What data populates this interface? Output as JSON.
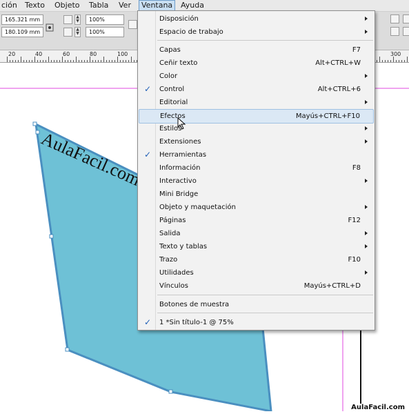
{
  "menubar": {
    "items": [
      "ción",
      "Texto",
      "Objeto",
      "Tabla",
      "Ver",
      "Ventana",
      "Ayuda"
    ],
    "active": "Ventana"
  },
  "toolbar": {
    "x_value": "165.321 mm",
    "y_value": "180.109 mm",
    "scale_x": "100%",
    "scale_y": "100%"
  },
  "ruler": {
    "labels": [
      "20",
      "40",
      "60",
      "80",
      "100",
      "300"
    ]
  },
  "canvas": {
    "shape_text": "AulaFacil.com",
    "shape_color": "#6ec1d6",
    "shape_border_color": "#4a8fc0"
  },
  "menu": {
    "items": [
      {
        "label": "Disposición",
        "submenu": true
      },
      {
        "label": "Espacio de trabajo",
        "submenu": true
      },
      {
        "label": "Capas",
        "shortcut": "F7"
      },
      {
        "label": "Ceñir texto",
        "shortcut": "Alt+CTRL+W"
      },
      {
        "label": "Color",
        "submenu": true
      },
      {
        "label": "Control",
        "shortcut": "Alt+CTRL+6",
        "checked": true
      },
      {
        "label": "Editorial",
        "submenu": true
      },
      {
        "label": "Efectos",
        "shortcut": "Mayús+CTRL+F10",
        "highlighted": true
      },
      {
        "label": "Estilos",
        "submenu": true
      },
      {
        "label": "Extensiones",
        "submenu": true
      },
      {
        "label": "Herramientas",
        "checked": true
      },
      {
        "label": "Información",
        "shortcut": "F8"
      },
      {
        "label": "Interactivo",
        "submenu": true
      },
      {
        "label": "Mini Bridge"
      },
      {
        "label": "Objeto y maquetación",
        "submenu": true
      },
      {
        "label": "Páginas",
        "shortcut": "F12"
      },
      {
        "label": "Salida",
        "submenu": true
      },
      {
        "label": "Texto y tablas",
        "submenu": true
      },
      {
        "label": "Trazo",
        "shortcut": "F10"
      },
      {
        "label": "Utilidades",
        "submenu": true
      },
      {
        "label": "Vínculos",
        "shortcut": "Mayús+CTRL+D"
      },
      {
        "label": "Botones de muestra"
      },
      {
        "label": "1 *Sin título-1 @ 75%",
        "checked": true
      }
    ]
  },
  "watermark": "AulaFacil.com",
  "colors": {
    "accent_check": "#1f5fb7",
    "menu_highlight": "#dbe8f5",
    "guide_magenta": "#e04ae0"
  }
}
